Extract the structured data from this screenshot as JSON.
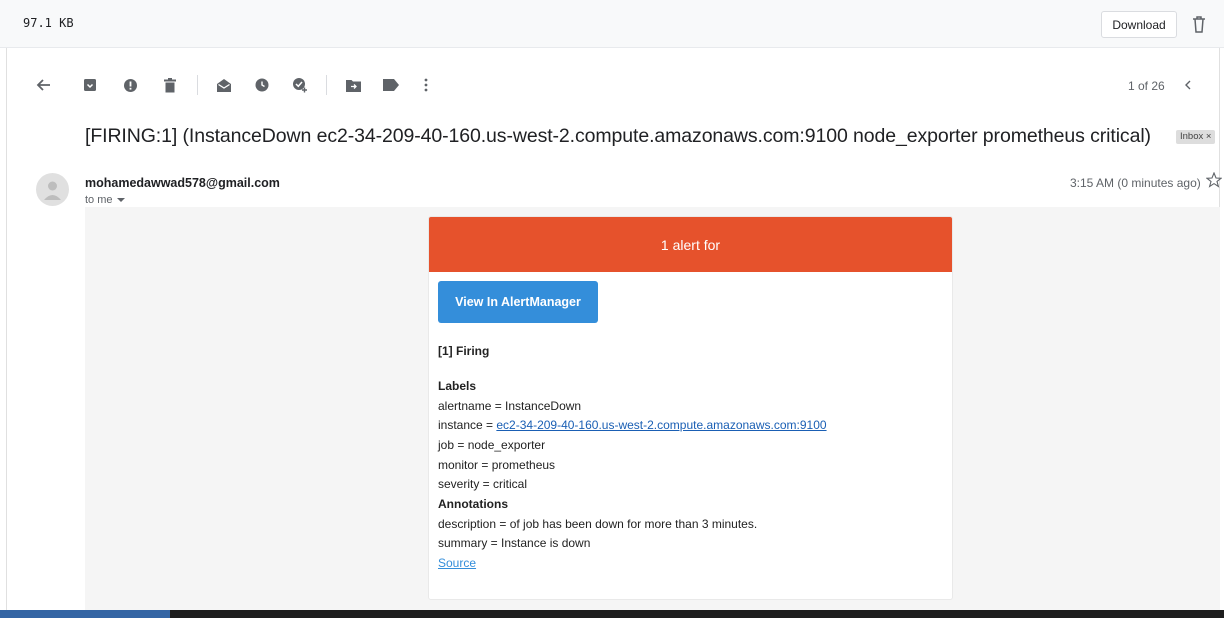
{
  "file_bar": {
    "size": "97.1 KB",
    "download_label": "Download"
  },
  "toolbar": {
    "pager": "1 of 26"
  },
  "message": {
    "subject": "[FIRING:1] (InstanceDown ec2-34-209-40-160.us-west-2.compute.amazonaws.com:9100 node_exporter prometheus critical)",
    "label": "Inbox ×",
    "sender": "mohamedawwad578@gmail.com",
    "to": "to me",
    "time": "3:15 AM (0 minutes ago)"
  },
  "alert": {
    "header": "1 alert for",
    "button_label": "View In AlertManager",
    "firing_heading": "[1] Firing",
    "labels_heading": "Labels",
    "alertname": "alertname = InstanceDown",
    "instance_prefix": "instance = ",
    "instance_link": "ec2-34-209-40-160.us-west-2.compute.amazonaws.com:9100",
    "job": "job = node_exporter",
    "monitor": "monitor = prometheus",
    "severity": "severity = critical",
    "annotations_heading": "Annotations",
    "description": "description = of job has been down for more than 3 minutes.",
    "summary": "summary = Instance is down",
    "source_link": "Source"
  },
  "colors": {
    "alert_header": "#e6522c",
    "button": "#348eda"
  },
  "icons": [
    "back-arrow-icon",
    "archive-icon",
    "report-spam-icon",
    "delete-icon",
    "mark-unread-icon",
    "snooze-icon",
    "add-task-icon",
    "move-to-icon",
    "label-icon",
    "more-vert-icon",
    "chevron-left-icon",
    "star-icon",
    "trash-icon"
  ]
}
